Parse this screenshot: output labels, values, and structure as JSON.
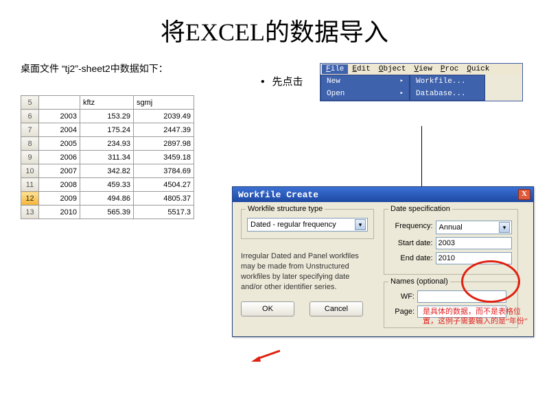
{
  "title": "将EXCEL的数据导入",
  "subtitle": "桌面文件 “tj2”-sheet2中数据如下：",
  "click_label": "先点击",
  "table": {
    "col2_hdr": "kftz",
    "col3_hdr": "sgmj",
    "rows": [
      {
        "n": "5",
        "a": "",
        "b": "",
        "c": ""
      },
      {
        "n": "6",
        "a": "2003",
        "b": "153.29",
        "c": "2039.49"
      },
      {
        "n": "7",
        "a": "2004",
        "b": "175.24",
        "c": "2447.39"
      },
      {
        "n": "8",
        "a": "2005",
        "b": "234.93",
        "c": "2897.98"
      },
      {
        "n": "9",
        "a": "2006",
        "b": "311.34",
        "c": "3459.18"
      },
      {
        "n": "10",
        "a": "2007",
        "b": "342.82",
        "c": "3784.69"
      },
      {
        "n": "11",
        "a": "2008",
        "b": "459.33",
        "c": "4504.27"
      },
      {
        "n": "12",
        "a": "2009",
        "b": "494.86",
        "c": "4805.37",
        "active": true
      },
      {
        "n": "13",
        "a": "2010",
        "b": "565.39",
        "c": "5517.3"
      }
    ]
  },
  "menubar": {
    "items": [
      "File",
      "Edit",
      "Object",
      "View",
      "Proc",
      "Quick"
    ],
    "left": [
      {
        "t": "New",
        "arrow": "▸"
      },
      {
        "t": "Open",
        "arrow": "▸"
      }
    ],
    "right": [
      {
        "t": "Workfile..."
      },
      {
        "t": "Database..."
      }
    ]
  },
  "dialog": {
    "title": "Workfile Create",
    "close": "X",
    "structure_legend": "Workfile structure type",
    "structure_value": "Dated - regular frequency",
    "hint": "Irregular Dated and Panel workfiles may be made from Unstructured workfiles by later specifying date and/or other identifier series.",
    "date_legend": "Date specification",
    "freq_label": "Frequency:",
    "freq_value": "Annual",
    "start_label": "Start date:",
    "start_value": "2003",
    "end_label": "End date:",
    "end_value": "2010",
    "names_legend": "Names (optional)",
    "wf_label": "WF:",
    "page_label": "Page:",
    "ok": "OK",
    "cancel": "Cancel"
  },
  "red_note": "是具体的数据，而不是表格位置，这例子需要输入的是“年份”"
}
